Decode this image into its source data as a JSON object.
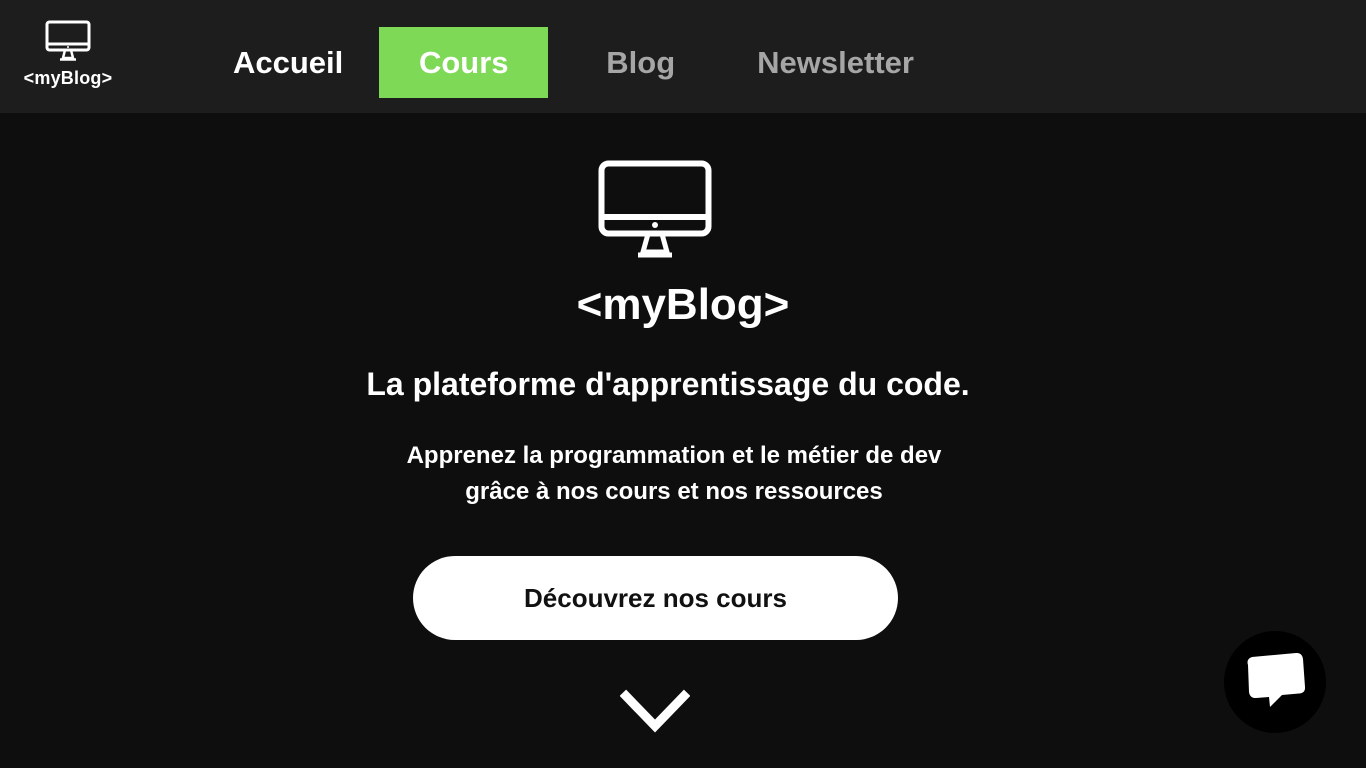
{
  "header": {
    "logo_text": "<myBlog>",
    "logo_icon": "monitor-icon",
    "nav": {
      "home": "Accueil",
      "courses": "Cours",
      "blog": "Blog",
      "newsletter": "Newsletter"
    },
    "active_color": "#7ed957"
  },
  "hero": {
    "icon": "monitor-icon",
    "title": "<myBlog>",
    "subtitle": "La plateforme d'apprentissage du code.",
    "description_line1": "Apprenez la programmation et le métier de dev",
    "description_line2": "grâce à nos cours et nos ressources",
    "cta_label": "Découvrez nos cours",
    "scroll_icon": "chevron-down-icon"
  },
  "chat": {
    "icon": "chat-bubble-icon"
  },
  "colors": {
    "header_bg": "#1d1d1d",
    "page_bg": "#0e0e0e",
    "accent": "#7ed957",
    "inactive_nav": "#a6a6a6"
  }
}
